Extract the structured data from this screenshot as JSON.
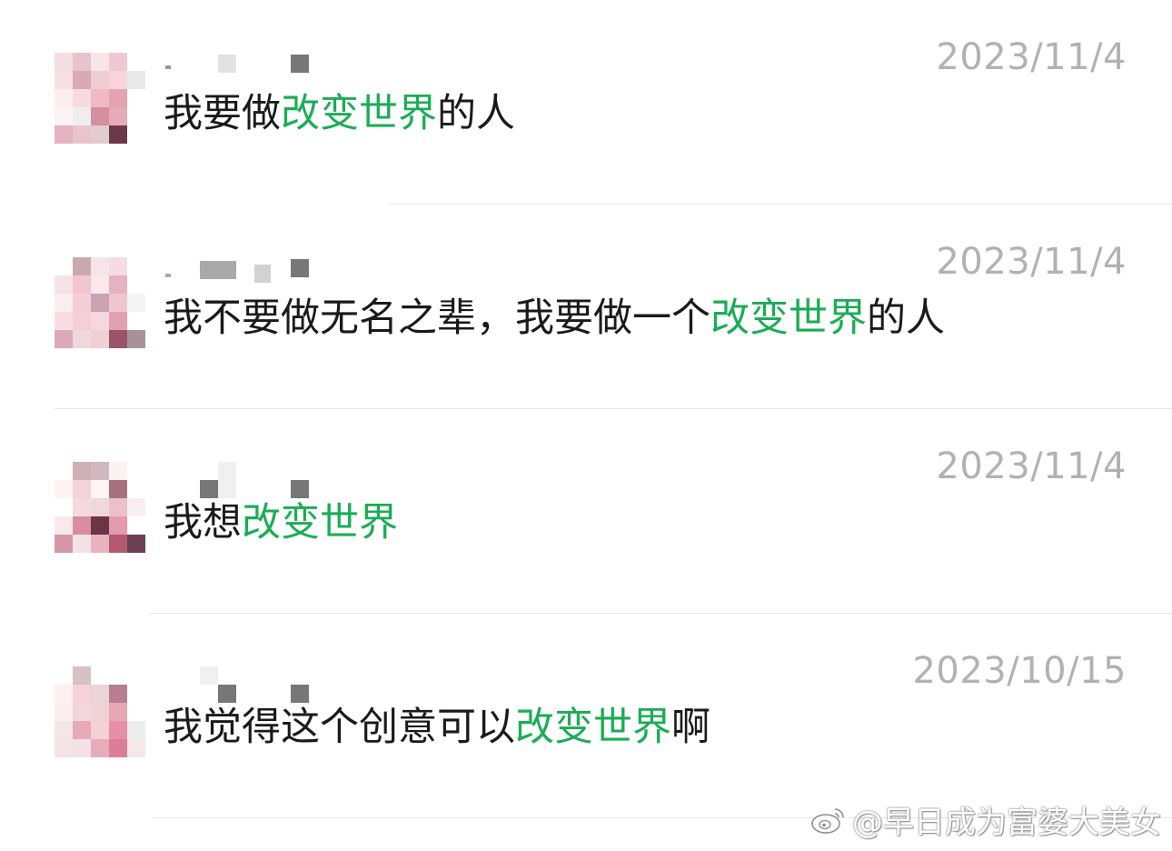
{
  "messages": [
    {
      "date": "2023/11/4",
      "text_before": "我要做",
      "highlight": "改变世界",
      "text_after": "的人"
    },
    {
      "date": "2023/11/4",
      "text_before": "我不要做无名之辈，我要做一个",
      "highlight": "改变世界",
      "text_after": "的人"
    },
    {
      "date": "2023/11/4",
      "text_before": "我想",
      "highlight": "改变世界",
      "text_after": ""
    },
    {
      "date": "2023/10/15",
      "text_before": "我觉得这个创意可以",
      "highlight": "改变世界",
      "text_after": "啊"
    }
  ],
  "watermark": {
    "text": "@早日成为富婆大美女",
    "icon": "weibo-icon"
  },
  "colors": {
    "highlight": "#1aad55",
    "date": "#b2b2b2",
    "text": "#1a1a1a",
    "divider": "#e6e6e6"
  }
}
